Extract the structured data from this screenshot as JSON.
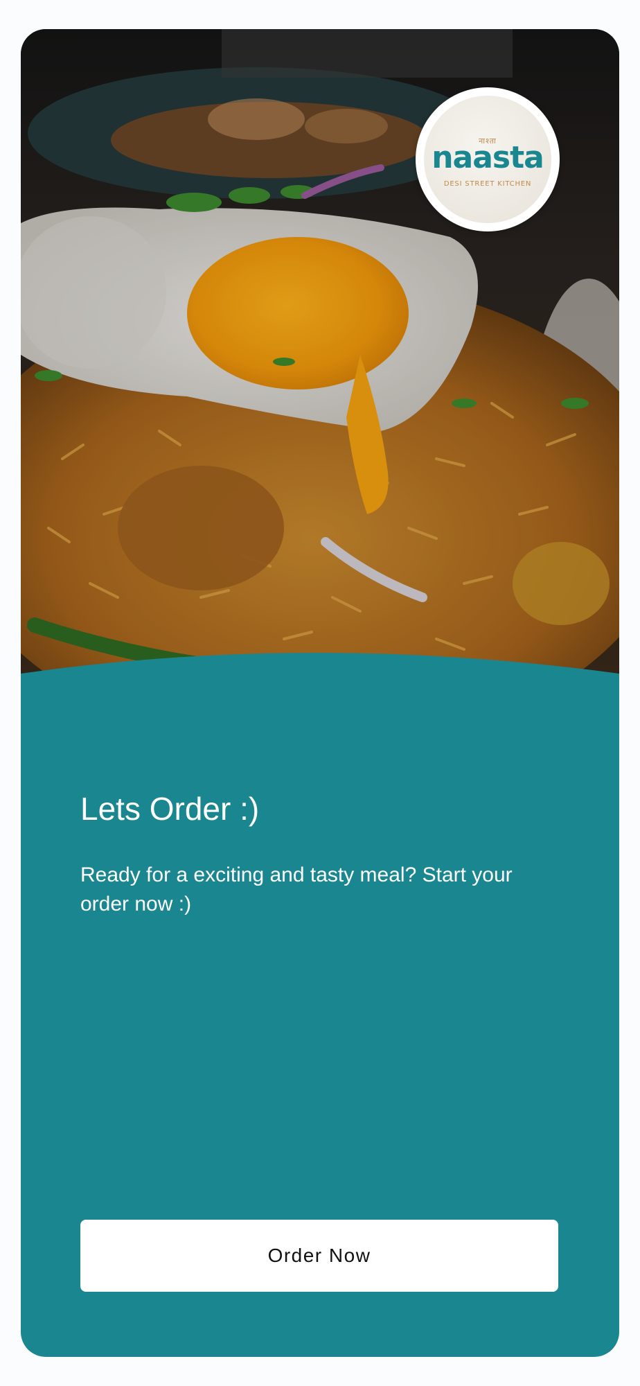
{
  "logo": {
    "hindi": "नाश्ता",
    "wordmark": "naasta",
    "tagline": "DESI STREET KITCHEN",
    "brand_color": "#1a8690",
    "accent_color": "#c0894a"
  },
  "hero_image": {
    "icon": "fried-egg-biryani-photo"
  },
  "main": {
    "title": "Lets Order :)",
    "subtitle": "Ready for a exciting and tasty meal? Start your order now :)",
    "background_color": "#1a8690"
  },
  "actions": {
    "order_button_label": "Order Now"
  }
}
